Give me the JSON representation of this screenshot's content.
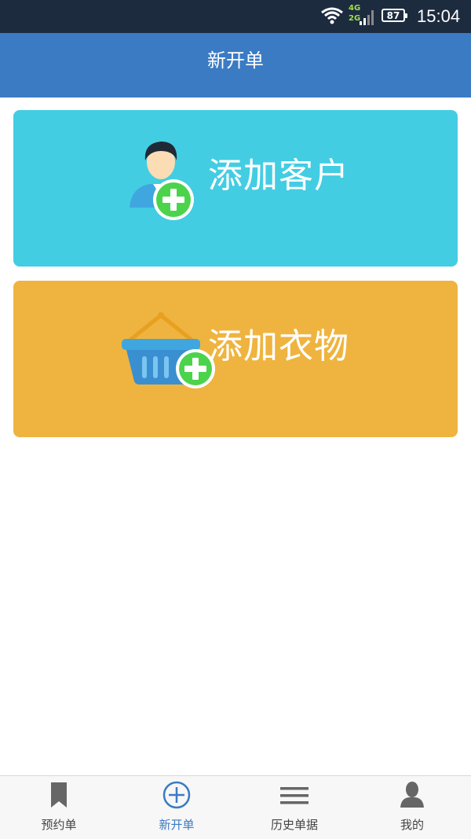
{
  "status_bar": {
    "network_top": "4G",
    "network_bottom": "2G",
    "battery": "87",
    "time": "15:04",
    "icons": [
      "wifi-icon",
      "signal-icon",
      "battery-icon"
    ]
  },
  "header": {
    "title": "新开单"
  },
  "cards": [
    {
      "label": "添加客户",
      "icon": "add-user-icon",
      "color": "#42cde3"
    },
    {
      "label": "添加衣物",
      "icon": "add-basket-icon",
      "color": "#efb43f"
    }
  ],
  "bottom_nav": {
    "items": [
      {
        "label": "预约单",
        "icon": "bookmark-icon",
        "active": false
      },
      {
        "label": "新开单",
        "icon": "plus-circle-icon",
        "active": true
      },
      {
        "label": "历史单据",
        "icon": "list-icon",
        "active": false
      },
      {
        "label": "我的",
        "icon": "person-icon",
        "active": false
      }
    ],
    "active_color": "#3b7bc4",
    "inactive_color": "#666666"
  },
  "colors": {
    "status_bar_bg": "#1d2b3f",
    "header_bg": "#3b7bc4",
    "plus_badge": "#4cd34c"
  }
}
